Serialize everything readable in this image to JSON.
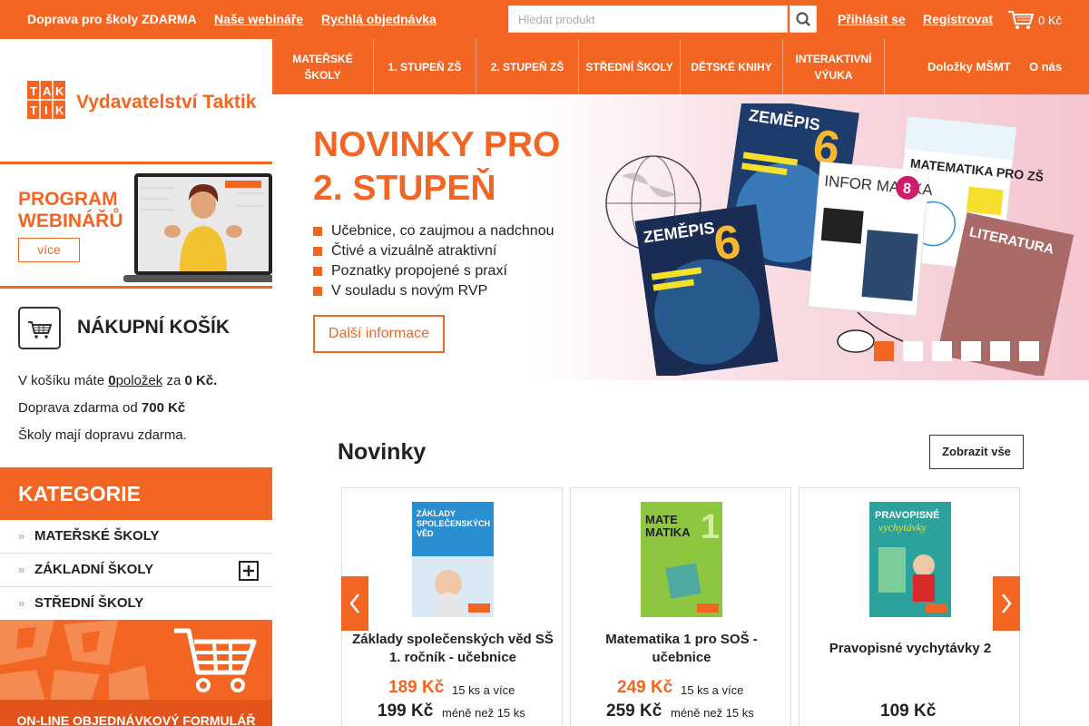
{
  "topbar": {
    "shipping": "Doprava pro školy ZDARMA",
    "webinars": "Naše webináře",
    "quick_order": "Rychlá objednávka",
    "search_placeholder": "Hledat produkt",
    "login": "Přihlásit se",
    "register": "Registrovat",
    "cart_total": "0 Kč"
  },
  "logo": {
    "mark_letters": [
      "T",
      "A",
      "K",
      "T",
      "I",
      "K"
    ],
    "text": "Vydavatelství Taktik"
  },
  "nav": {
    "items": [
      "MATEŘSKÉ ŠKOLY",
      "1. STUPEŇ ZŠ",
      "2. STUPEŇ ZŠ",
      "STŘEDNÍ ŠKOLY",
      "DĚTSKÉ KNIHY",
      "INTERAKTIVNÍ VÝUKA"
    ],
    "right": [
      "Doložky MŠMT",
      "O nás"
    ]
  },
  "webinar": {
    "title_line1": "PROGRAM",
    "title_line2": "WEBINÁŘŮ",
    "button": "více"
  },
  "cart": {
    "title": "NÁKUPNÍ KOŠÍK",
    "line1_prefix": "V košíku máte",
    "line1_count": "0",
    "line1_items": "položek",
    "line1_mid": "za",
    "line1_price": "0 Kč.",
    "line2_prefix": "Doprava zdarma od",
    "line2_value": "700 Kč",
    "line3": "Školy mají dopravu zdarma."
  },
  "categories": {
    "title": "KATEGORIE",
    "items": [
      "MATEŘSKÉ ŠKOLY",
      "ZÁKLADNÍ ŠKOLY",
      "STŘEDNÍ ŠKOLY"
    ]
  },
  "order_form": {
    "label": "ON-LINE OBJEDNÁVKOVÝ FORMULÁŘ"
  },
  "hero": {
    "title_line1": "NOVINKY PRO",
    "title_line2": "2. STUPEŇ",
    "bullets": [
      "Učebnice, co zaujmou a nadchnou",
      "Čtivé a vizuálně atraktivní",
      "Poznatky propojené s praxí",
      "V souladu s novým RVP"
    ],
    "button": "Další informace",
    "books": [
      "ZEMĚPIS",
      "INFOR MATIKA",
      "MATEMATIKA PRO ZŠ",
      "LITERATURA"
    ],
    "slides": 6,
    "active_slide": 1
  },
  "novinky": {
    "title": "Novinky",
    "show_all": "Zobrazit vše",
    "products": [
      {
        "name": "Základy společenských věd SŠ 1. ročník - učebnice",
        "price_bulk": "189 Kč",
        "bulk_note": "15 ks a více",
        "price": "199 Kč",
        "price_note": "méně než 15 ks",
        "cover_title": "ZÁKLADY SPOLEČENSKÝCH VĚD",
        "cover_color": "#2a8fd0"
      },
      {
        "name": "Matematika 1 pro SOŠ - učebnice",
        "price_bulk": "249 Kč",
        "bulk_note": "15 ks a více",
        "price": "259 Kč",
        "price_note": "méně než 15 ks",
        "cover_title": "MATE MATIKA",
        "cover_color": "#8dc63f"
      },
      {
        "name": "Pravopisné vychytávky 2",
        "price": "109 Kč",
        "cover_title": "PRAVOPISNÉ vychytávky",
        "cover_color": "#2ba39c"
      }
    ]
  },
  "colors": {
    "brand": "#f26522"
  }
}
